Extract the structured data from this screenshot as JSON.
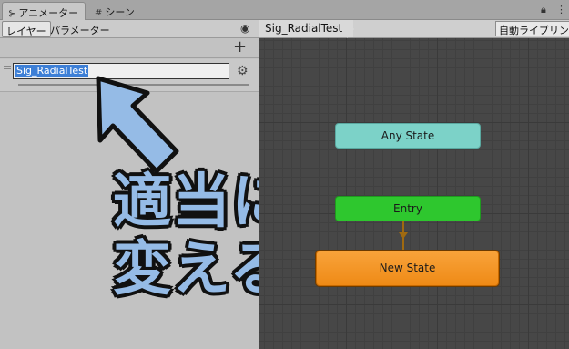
{
  "tabs": {
    "animator_label": "アニメーター",
    "scene_label": "シーン"
  },
  "left_panel": {
    "subtab_layers": "レイヤー",
    "subtab_parameters": "パラメーター",
    "layer_name_value": "Sig_RadialTest"
  },
  "graph": {
    "breadcrumb": "Sig_RadialTest",
    "auto_layout_label": "自動ライブリンク",
    "nodes": {
      "any_state": "Any State",
      "entry": "Entry",
      "new_state": "New State"
    }
  },
  "annotation": {
    "line1": "適当に",
    "line2": "変える"
  },
  "colors": {
    "any_state": "#7cd2c8",
    "entry": "#2ec72e",
    "new_state": "#f29626",
    "annotation_fill": "#95bbe6",
    "selection": "#3d7fd6"
  },
  "icons": [
    "animator-icon",
    "scene-grid-icon",
    "lock-icon",
    "menu-icon",
    "eye-icon",
    "plus-icon",
    "gear-icon",
    "arrow-pointer-icon"
  ]
}
